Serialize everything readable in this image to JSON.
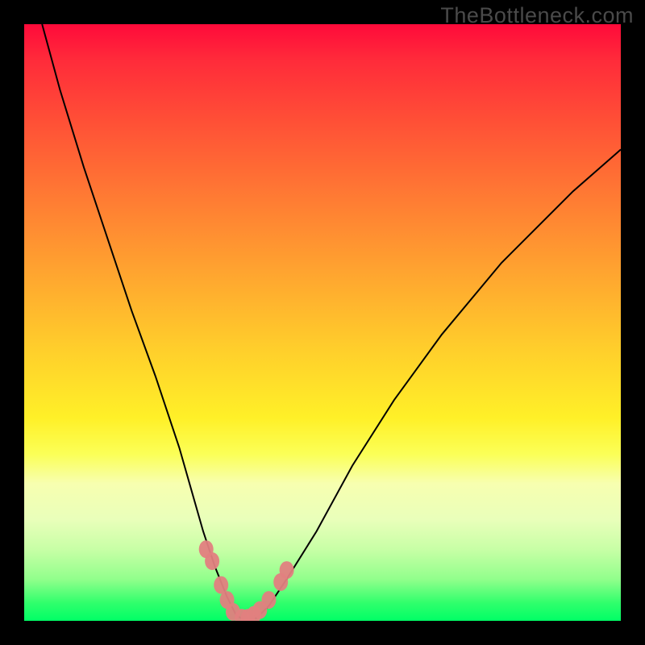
{
  "watermark": "TheBottleneck.com",
  "chart_data": {
    "type": "line",
    "title": "",
    "xlabel": "",
    "ylabel": "",
    "x_range": [
      0,
      100
    ],
    "y_range": [
      0,
      100
    ],
    "series": [
      {
        "name": "bottleneck-curve",
        "x": [
          3,
          6,
          10,
          14,
          18,
          22,
          26,
          28,
          30,
          32,
          34,
          35.5,
          37,
          39,
          41,
          44,
          49,
          55,
          62,
          70,
          80,
          92,
          100
        ],
        "values": [
          100,
          89,
          76,
          64,
          52,
          41,
          29,
          22,
          15,
          9,
          4,
          1,
          0,
          0.5,
          2.5,
          7,
          15,
          26,
          37,
          48,
          60,
          72,
          79
        ]
      }
    ],
    "annotations": [
      {
        "name": "threshold-markers",
        "type": "points",
        "color": "#e28080",
        "x": [
          30.5,
          31.5,
          33.0,
          34.0,
          35.0,
          36.5,
          37.5,
          38.5,
          39.5,
          41.0,
          43.0,
          44.0
        ],
        "values": [
          12.0,
          10.0,
          6.0,
          3.5,
          1.5,
          0.5,
          0.5,
          1.0,
          1.8,
          3.5,
          6.5,
          8.5
        ]
      }
    ]
  }
}
